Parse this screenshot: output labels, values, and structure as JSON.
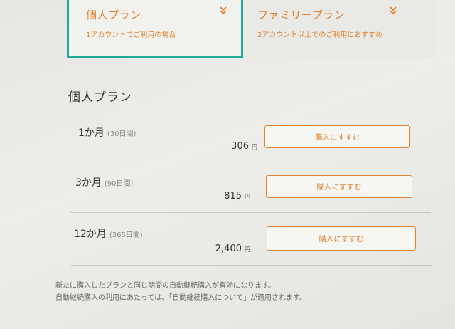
{
  "tabs": [
    {
      "title": "個人プラン",
      "subtitle": "1アカウントでご利用の場合"
    },
    {
      "title": "ファミリープラン",
      "subtitle": "2アカウント以上でのご利用におすすめ"
    }
  ],
  "section": {
    "title": "個人プラン"
  },
  "plans": [
    {
      "name": "1か月",
      "days": "(30日間)",
      "price": "306",
      "currency": "円",
      "button": "購入にすすむ"
    },
    {
      "name": "3か月",
      "days": "(90日間)",
      "price": "815",
      "currency": "円",
      "button": "購入にすすむ"
    },
    {
      "name": "12か月",
      "days": "(365日間)",
      "price": "2,400",
      "currency": "円",
      "button": "購入にすすむ"
    }
  ],
  "notes": [
    "新たに購入したプランと同じ期間の自動継続購入が有効になります。",
    "自動継続購入の利用にあたっては、「自動継続購入について」が適用されます。"
  ],
  "colors": {
    "accent": "#e2822f",
    "active_border": "#21a99a"
  }
}
